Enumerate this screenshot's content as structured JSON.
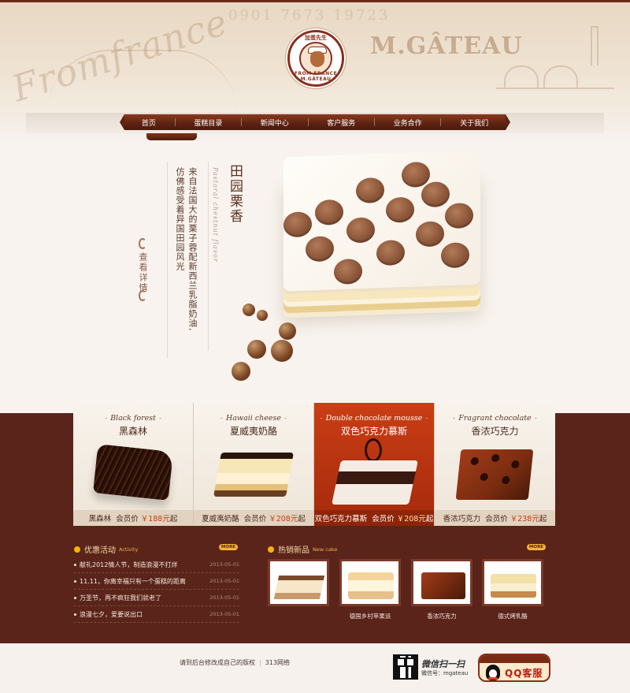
{
  "header": {
    "deco_script": "Fromfrance",
    "deco_numbers": "0901 7673 19723",
    "brand": "M.GÂTEAU",
    "logo_top": "加蛋先生",
    "logo_bottom": "FROM FRANCE M.GÂTEAU"
  },
  "nav": {
    "items": [
      {
        "label": "首页"
      },
      {
        "label": "蛋糕目录"
      },
      {
        "label": "新闻中心"
      },
      {
        "label": "客户服务"
      },
      {
        "label": "业务合作"
      },
      {
        "label": "关于我们"
      }
    ]
  },
  "hero": {
    "title": "田园栗香",
    "subtitle": "Pastoral chestnut flavor",
    "desc_line1": "来自法国大的栗子蓉配新西兰乳脂奶油,",
    "desc_line2": "仿佛感受着异国田园风光",
    "view_details": "查看详情"
  },
  "products": [
    {
      "en": "Black forest",
      "cn": "黑森林",
      "name": "黑森林",
      "member_label": "会员价",
      "price": "￥188元",
      "suffix": "起",
      "active": false
    },
    {
      "en": "Hawaii cheese",
      "cn": "夏威夷奶酪",
      "name": "夏威夷奶酪",
      "member_label": "会员价",
      "price": "￥208元",
      "suffix": "起",
      "active": false
    },
    {
      "en": "Double chocolate mousse",
      "cn": "双色巧克力慕斯",
      "name": "双色巧克力慕斯",
      "member_label": "会员价",
      "price": "￥208元",
      "suffix": "起",
      "active": true
    },
    {
      "en": "Fragrant chocolate",
      "cn": "香浓巧克力",
      "name": "香浓巧克力",
      "member_label": "会员价",
      "price": "￥238元",
      "suffix": "起",
      "active": false
    }
  ],
  "promotions": {
    "title": "优惠活动",
    "subtitle": "Activity",
    "more": "MORE",
    "items": [
      {
        "text": "献礼2012情人节，制造浪漫不打烊",
        "date": "2013-05-01"
      },
      {
        "text": "11.11，你离幸福只有一个蛋糕的距离",
        "date": "2013-05-01"
      },
      {
        "text": "万圣节，再不疯狂我们就老了",
        "date": "2013-05-01"
      },
      {
        "text": "浪漫七夕，爱要说出口",
        "date": "2013-05-01"
      }
    ]
  },
  "new_cakes": {
    "title": "热销新品",
    "subtitle": "New cake",
    "more": "MORE",
    "items": [
      {
        "caption": ""
      },
      {
        "caption": "德国乡村苹果派"
      },
      {
        "caption": "香浓巧克力"
      },
      {
        "caption": "德式烤乳酪"
      }
    ]
  },
  "footer": {
    "notice": "请到后台修改成自己的版权",
    "site": "313网络",
    "wechat_title": "微信扫一扫",
    "wechat_id": "微信号：mgateau",
    "qq_label": "QQ客服"
  },
  "colors": {
    "dark_band": "#5a241a",
    "accent_red": "#c93e15",
    "nav_brown": "#5c2212",
    "price_red": "#c33a12"
  }
}
